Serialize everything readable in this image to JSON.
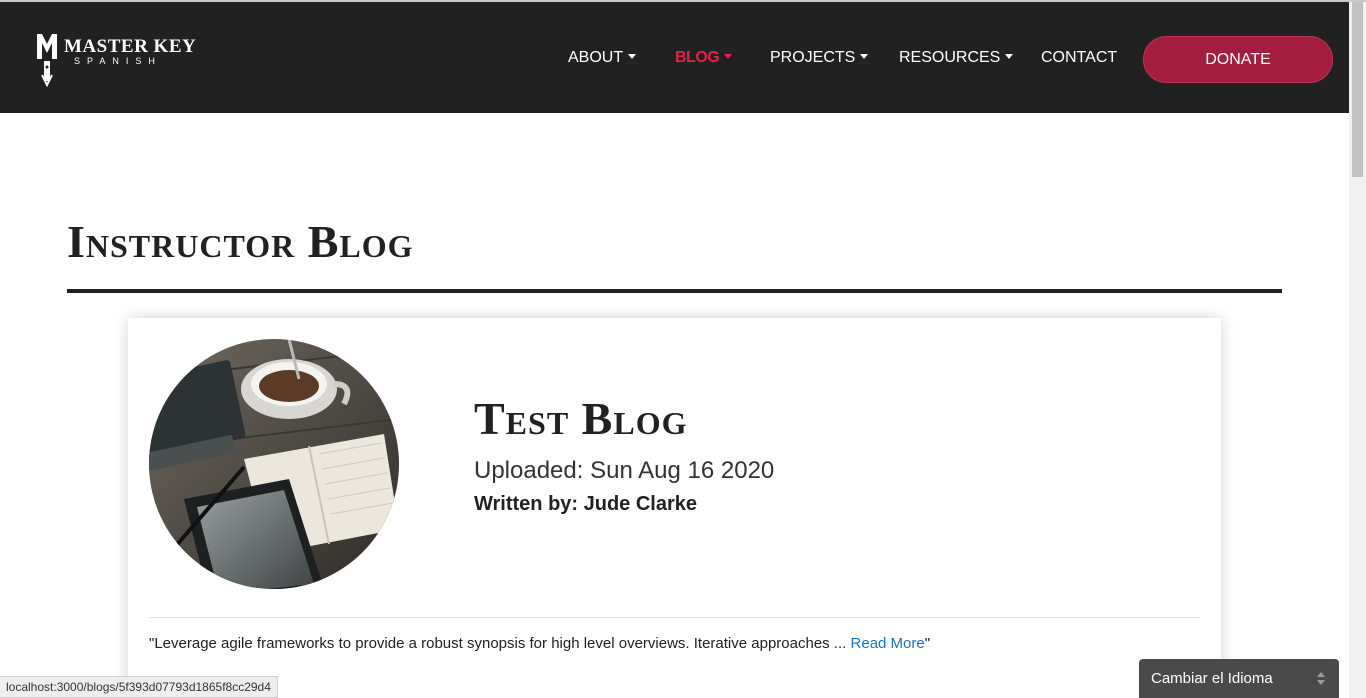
{
  "brand": {
    "name_main": "MASTER KEY",
    "name_sub": "SPANISH"
  },
  "nav": {
    "items": [
      {
        "label": "ABOUT",
        "dropdown": true
      },
      {
        "label": "BLOG",
        "dropdown": true,
        "active": true
      },
      {
        "label": "PROJECTS",
        "dropdown": true
      },
      {
        "label": "RESOURCES",
        "dropdown": true
      },
      {
        "label": "CONTACT",
        "dropdown": false
      }
    ],
    "donate_label": "DONATE"
  },
  "page": {
    "title": "Instructor Blog"
  },
  "blog_card": {
    "thumbnail_icon": "coffee-notebook-tablet-image",
    "title": "Test Blog",
    "uploaded": "Uploaded: Sun Aug 16 2020",
    "author": "Written by: Jude Clarke",
    "excerpt_prefix": "\"Leverage agile frameworks to provide a robust synopsis for high level overviews. Iterative approaches ... ",
    "read_more_label": "Read More",
    "excerpt_suffix": "\""
  },
  "status_bar": {
    "url": "localhost:3000/blogs/5f393d07793d1865f8cc29d4"
  },
  "language_selector": {
    "label": "Cambiar el Idioma"
  },
  "colors": {
    "nav_bg": "#212121",
    "active_link": "#e0224d",
    "donate_bg": "#a31d3f",
    "link": "#1a73c9"
  }
}
